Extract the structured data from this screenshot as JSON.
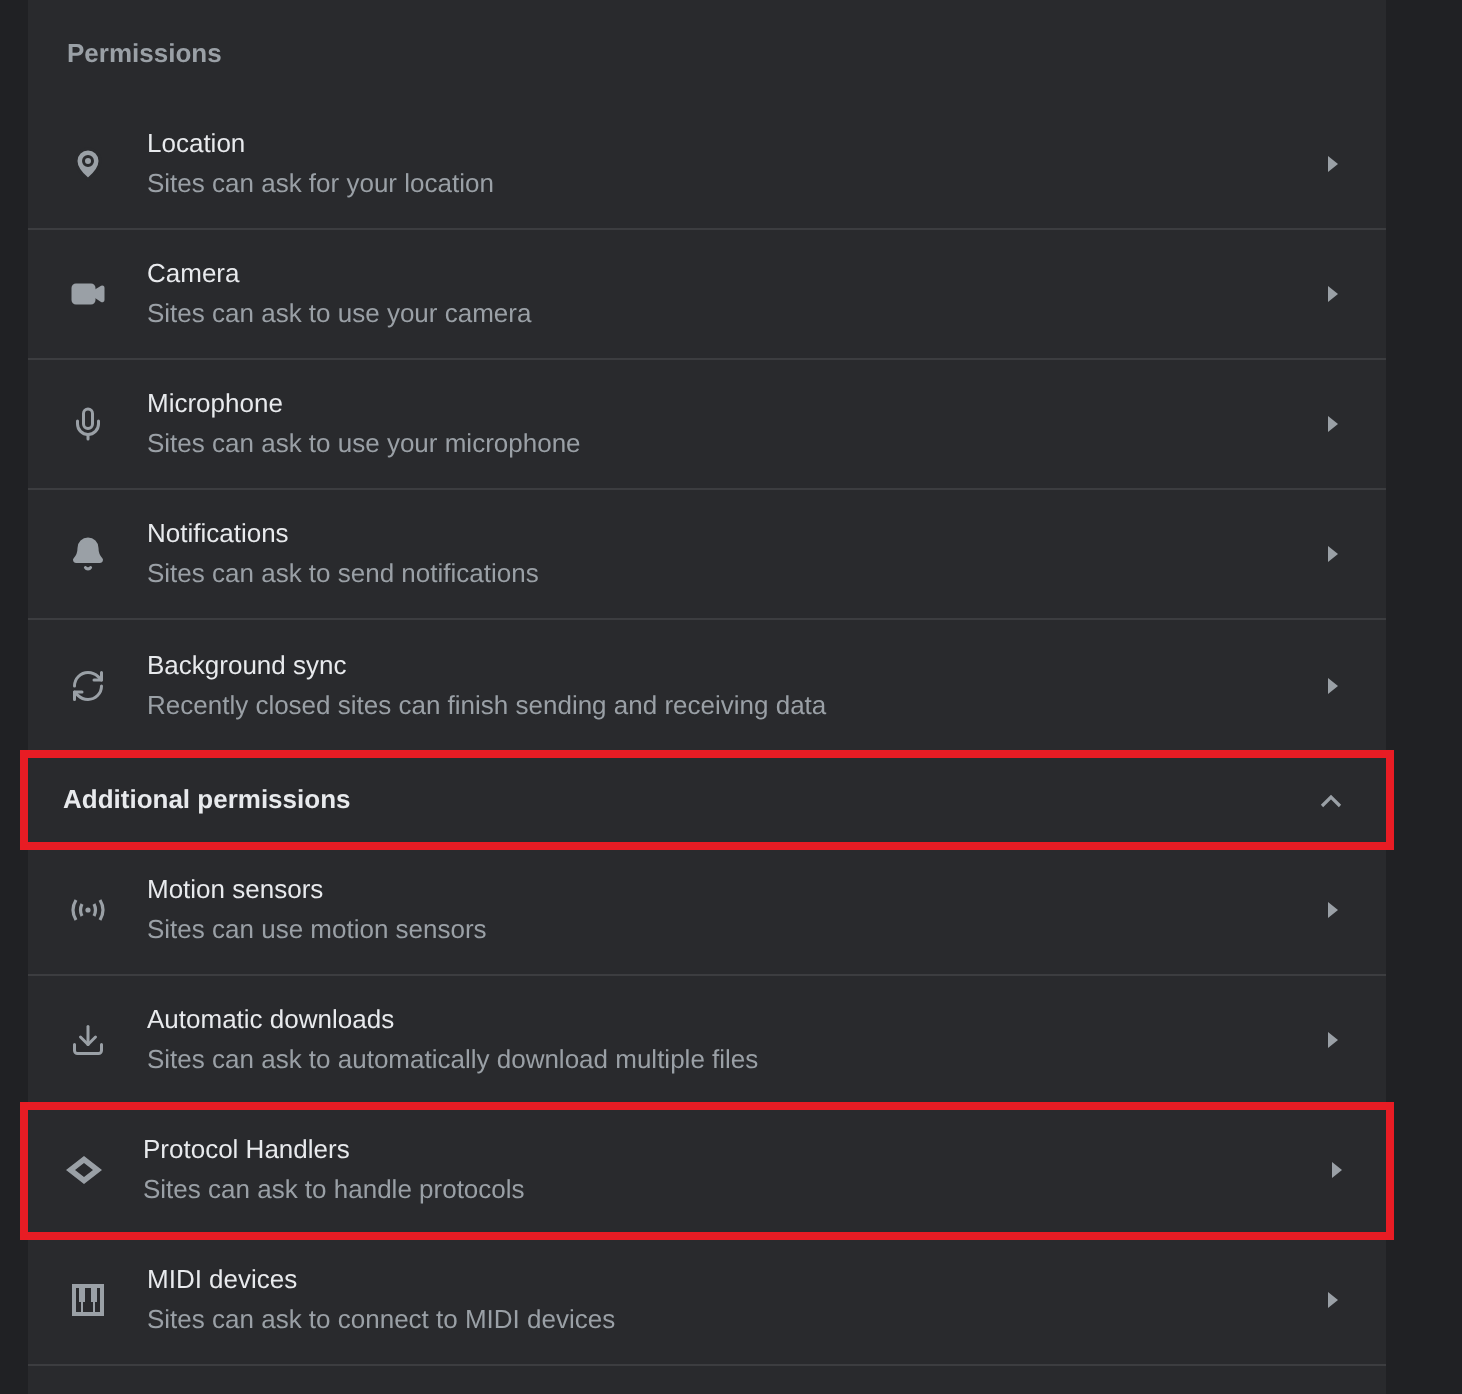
{
  "section_title": "Permissions",
  "permissions": [
    {
      "title": "Location",
      "subtitle": "Sites can ask for your location",
      "highlighted": false
    },
    {
      "title": "Camera",
      "subtitle": "Sites can ask to use your camera",
      "highlighted": false
    },
    {
      "title": "Microphone",
      "subtitle": "Sites can ask to use your microphone",
      "highlighted": false
    },
    {
      "title": "Notifications",
      "subtitle": "Sites can ask to send notifications",
      "highlighted": false
    },
    {
      "title": "Background sync",
      "subtitle": "Recently closed sites can finish sending and receiving data",
      "highlighted": false
    }
  ],
  "additional": {
    "title": "Additional permissions",
    "expanded": true,
    "highlighted": true
  },
  "additional_permissions": [
    {
      "title": "Motion sensors",
      "subtitle": "Sites can use motion sensors",
      "highlighted": false
    },
    {
      "title": "Automatic downloads",
      "subtitle": "Sites can ask to automatically download multiple files",
      "highlighted": false
    },
    {
      "title": "Protocol Handlers",
      "subtitle": "Sites can ask to handle protocols",
      "highlighted": true
    },
    {
      "title": "MIDI devices",
      "subtitle": "Sites can ask to connect to MIDI devices",
      "highlighted": false
    }
  ]
}
